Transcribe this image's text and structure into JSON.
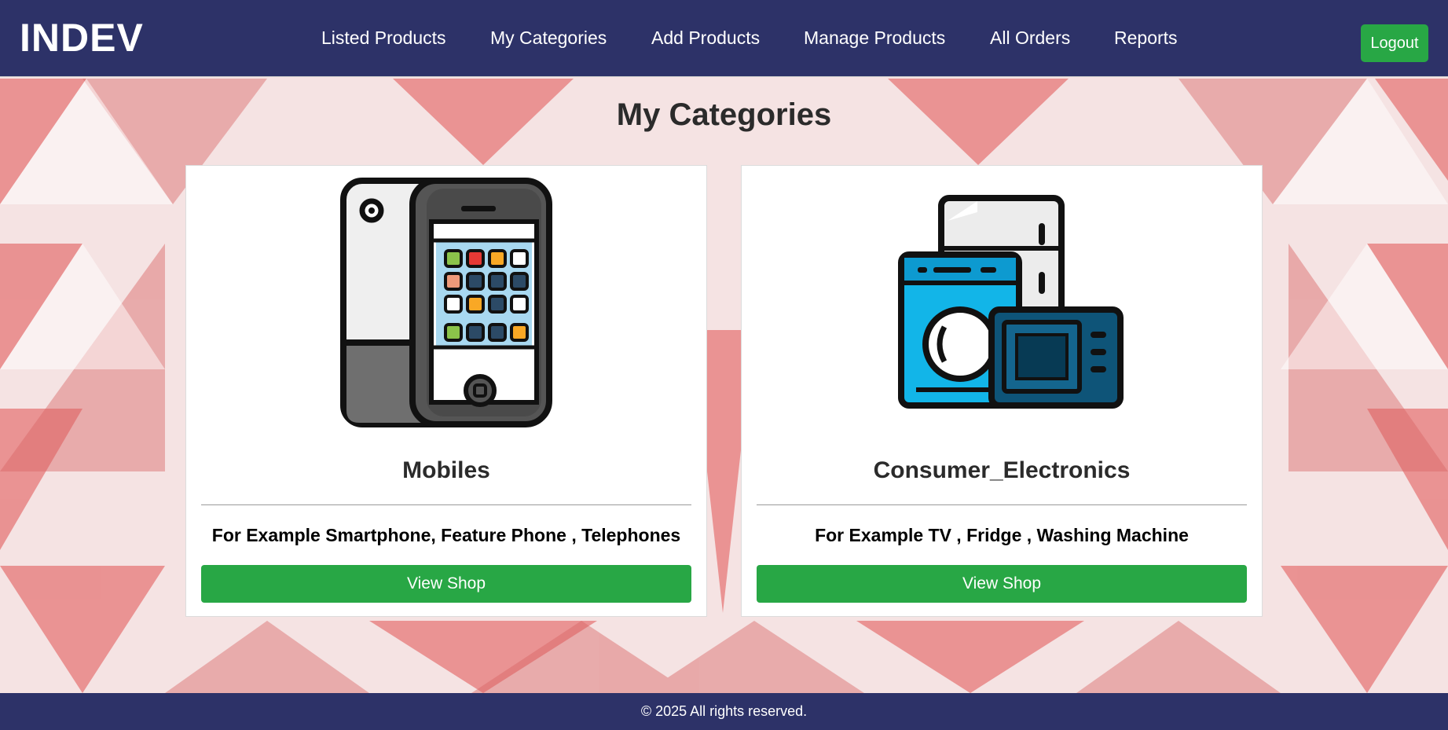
{
  "header": {
    "logo": "INDEV",
    "nav": [
      "Listed Products",
      "My Categories",
      "Add Products",
      "Manage Products",
      "All Orders",
      "Reports"
    ],
    "logout_label": "Logout"
  },
  "main": {
    "title": "My Categories",
    "categories": [
      {
        "name": "Mobiles",
        "description": "For Example Smartphone, Feature Phone , Telephones",
        "button_label": "View Shop",
        "icon": "mobile-phones-icon"
      },
      {
        "name": "Consumer_Electronics",
        "description": "For Example TV , Fridge , Washing Machine",
        "button_label": "View Shop",
        "icon": "home-appliances-icon"
      }
    ]
  },
  "footer": {
    "text": "© 2025 All rights reserved."
  },
  "colors": {
    "header_bg": "#2d3268",
    "accent_green": "#28a745",
    "pattern_red": "#e57878"
  }
}
